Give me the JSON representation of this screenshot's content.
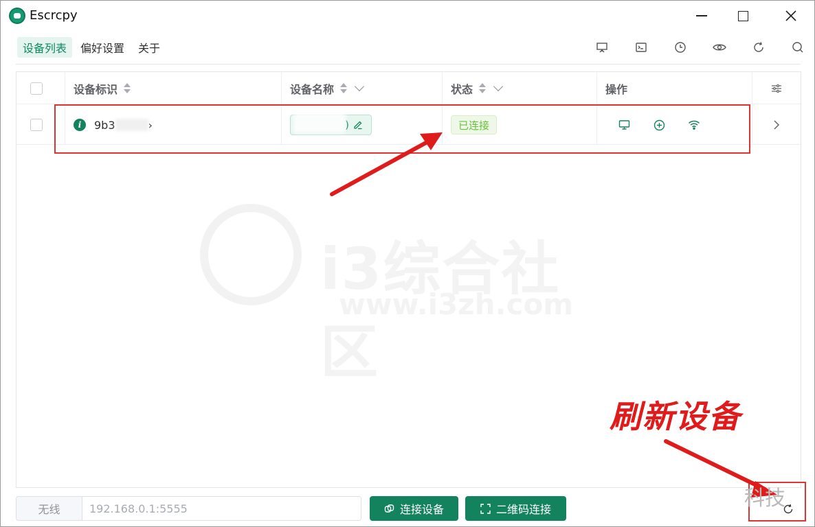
{
  "window": {
    "title": "Escrcpy"
  },
  "nav": {
    "tabs": [
      {
        "label": "设备列表",
        "active": true
      },
      {
        "label": "偏好设置",
        "active": false
      },
      {
        "label": "关于",
        "active": false
      }
    ]
  },
  "toolbar": {
    "icons": [
      "presentation-icon",
      "terminal-icon",
      "clock-icon",
      "eye-icon",
      "refresh-icon",
      "search-icon"
    ]
  },
  "table": {
    "columns": {
      "id": "设备标识",
      "name": "设备名称",
      "status": "状态",
      "actions": "操作"
    },
    "rows": [
      {
        "id": "9b3",
        "id_suffix": "›",
        "name_suffix": ")",
        "status": "已连接",
        "actions": [
          "monitor-icon",
          "plus-circle-icon",
          "wifi-icon"
        ]
      }
    ]
  },
  "annotation": {
    "label": "刷新设备",
    "color": "#e01b1b"
  },
  "watermark": {
    "main": "i3综合社区",
    "url": "www.i3zh.com",
    "corner": "科技"
  },
  "bottom": {
    "prefix": "无线",
    "placeholder": "192.168.0.1:5555",
    "connect_label": "连接设备",
    "qr_label": "二维码连接"
  },
  "colors": {
    "primary": "#13835e",
    "success": "#67c23a",
    "annotation": "#e23232"
  }
}
